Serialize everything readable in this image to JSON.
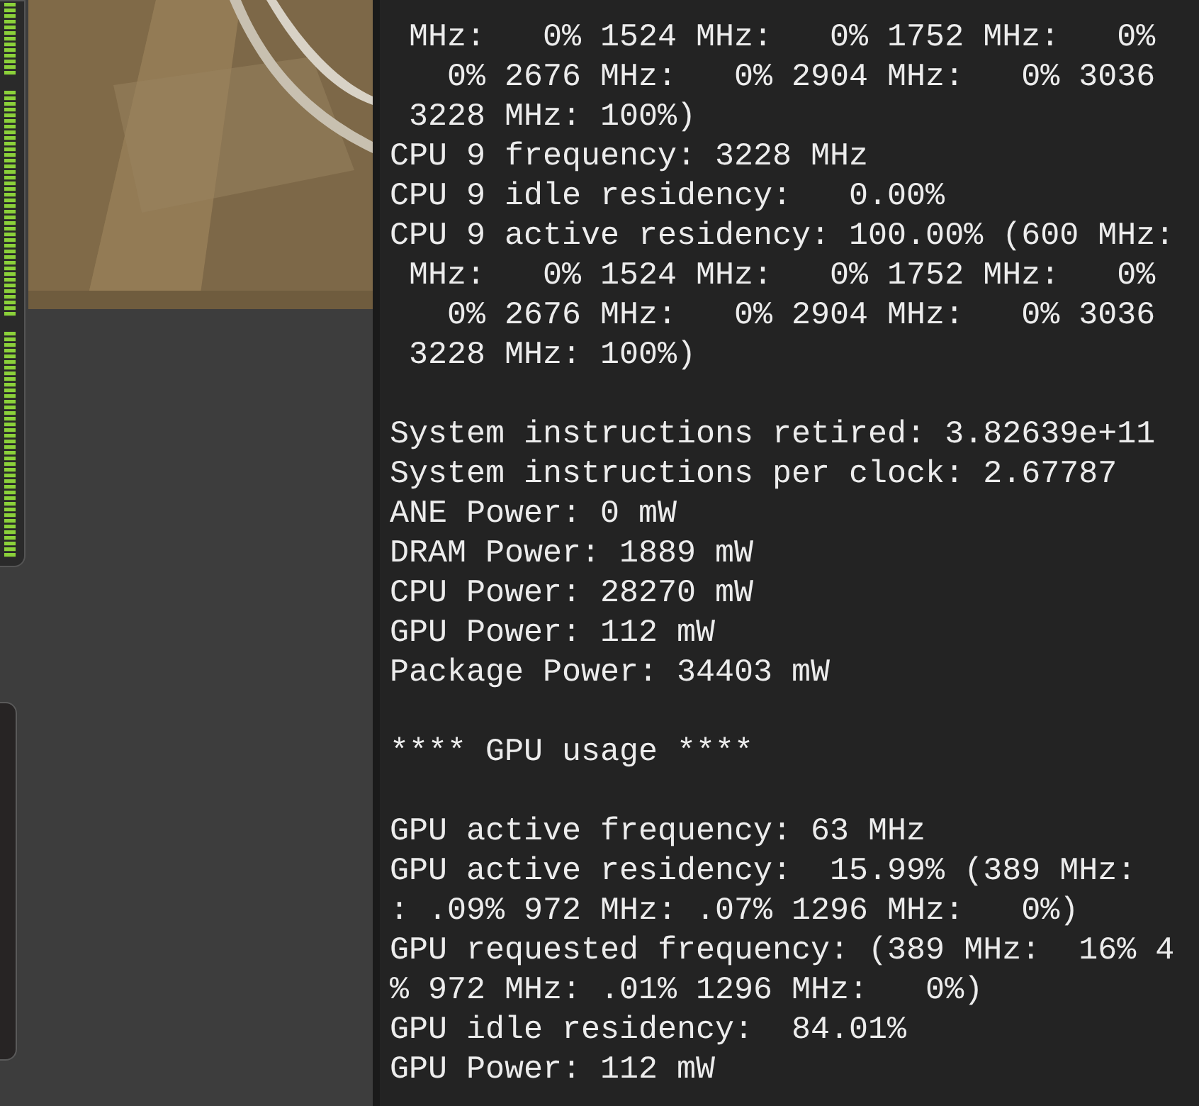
{
  "terminal": {
    "groups": [
      {
        "lines": [
          " MHz:   0% 1524 MHz:   0% 1752 MHz:   0%",
          "   0% 2676 MHz:   0% 2904 MHz:   0% 3036",
          " 3228 MHz: 100%)",
          "CPU 9 frequency: 3228 MHz",
          "CPU 9 idle residency:   0.00%",
          "CPU 9 active residency: 100.00% (600 MHz:",
          " MHz:   0% 1524 MHz:   0% 1752 MHz:   0%",
          "   0% 2676 MHz:   0% 2904 MHz:   0% 3036",
          " 3228 MHz: 100%)"
        ]
      },
      {
        "lines": [
          "System instructions retired: 3.82639e+11",
          "System instructions per clock: 2.67787",
          "ANE Power: 0 mW",
          "DRAM Power: 1889 mW",
          "CPU Power: 28270 mW",
          "GPU Power: 112 mW",
          "Package Power: 34403 mW"
        ]
      },
      {
        "lines": [
          "**** GPU usage ****"
        ]
      },
      {
        "lines": [
          "GPU active frequency: 63 MHz",
          "GPU active residency:  15.99% (389 MHz:",
          ": .09% 972 MHz: .07% 1296 MHz:   0%)",
          "GPU requested frequency: (389 MHz:  16% 4",
          "% 972 MHz: .01% 1296 MHz:   0%)",
          "GPU idle residency:  84.01%",
          "GPU Power: 112 mW"
        ]
      }
    ]
  }
}
